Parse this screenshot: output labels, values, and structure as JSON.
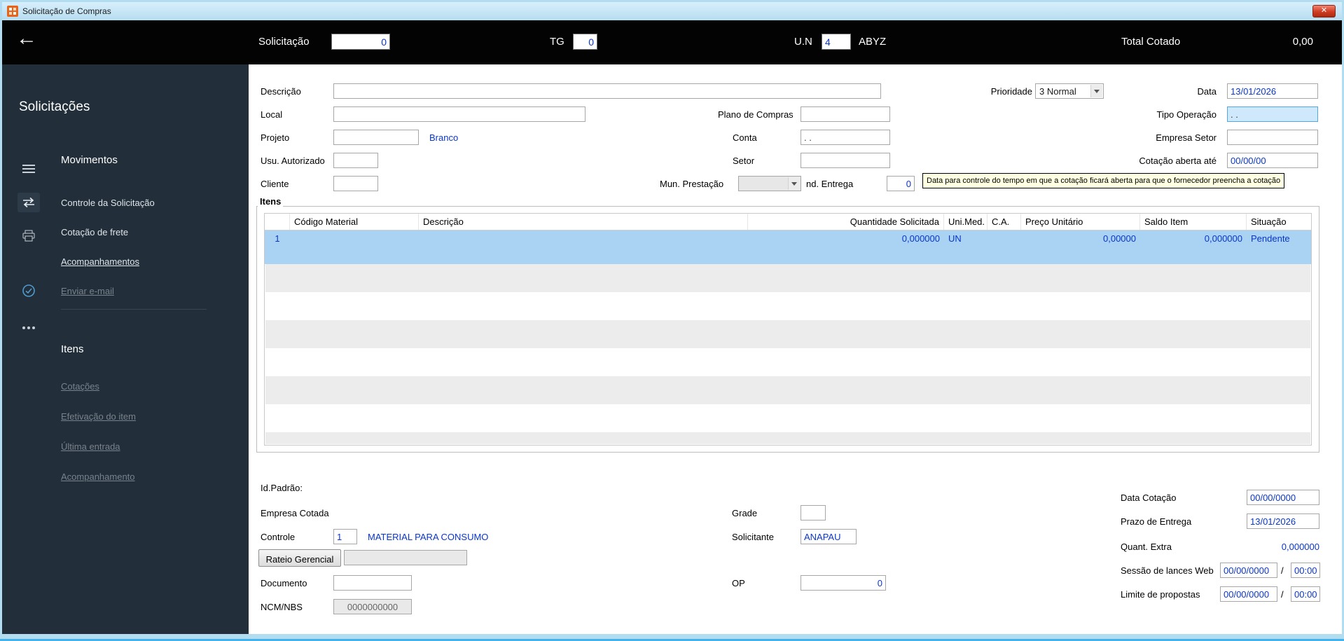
{
  "colors": {
    "accent_blue_text": "#0a36c8",
    "selected_row": "#a9d2f3",
    "tooltip_bg": "#ffffe1",
    "sidebar_bg": "#222e3a",
    "titlebar_bg": "#b6ddf0",
    "appbar_bg": "#030303",
    "close_button": "#cf3d22",
    "app_icon_orange": "#e8641b"
  },
  "titlebar": {
    "title": "Solicitação de Compras",
    "close": "✕"
  },
  "appbar": {
    "back": "←",
    "solicitacao": {
      "label": "Solicitação",
      "value": "0"
    },
    "tg": {
      "label": "TG",
      "value": "0"
    },
    "un": {
      "label": "U.N",
      "value": "4",
      "name": "ABYZ"
    },
    "total": {
      "label": "Total Cotado",
      "value": "0,00"
    }
  },
  "sidebar": {
    "title": "Solicitações",
    "movimentos": {
      "heading": "Movimentos",
      "items": [
        {
          "label": "Controle da Solicitação"
        },
        {
          "label": "Cotação de frete"
        },
        {
          "label": "Acompanhamentos"
        },
        {
          "label": "Enviar e-mail"
        }
      ]
    },
    "itens": {
      "heading": "Itens",
      "items": [
        {
          "label": "Cotações"
        },
        {
          "label": "Efetivação do item"
        },
        {
          "label": "Última entrada"
        },
        {
          "label": "Acompanhamento"
        }
      ]
    }
  },
  "form": {
    "descricao": {
      "label": "Descrição",
      "value": ""
    },
    "prioridade": {
      "label": "Prioridade",
      "value": "3 Normal"
    },
    "data": {
      "label": "Data",
      "value": "13/01/2026"
    },
    "local": {
      "label": "Local",
      "value": ""
    },
    "plano_compras": {
      "label": "Plano de Compras",
      "value": ""
    },
    "tipo_operacao": {
      "label": "Tipo Operação",
      "value": ". ."
    },
    "projeto": {
      "label": "Projeto",
      "value": "",
      "link": "Branco"
    },
    "conta": {
      "label": "Conta",
      "value": ". ."
    },
    "empresa_setor": {
      "label": "Empresa Setor",
      "value": ""
    },
    "usu_autorizado": {
      "label": "Usu. Autorizado",
      "value": ""
    },
    "setor": {
      "label": "Setor",
      "value": ""
    },
    "cotacao_aberta": {
      "label": "Cotação aberta até",
      "value": "00/00/00"
    },
    "cliente": {
      "label": "Cliente",
      "value": ""
    },
    "mun_prestacao": {
      "label": "Mun. Prestação",
      "value": ""
    },
    "und_entrega": {
      "label": "nd. Entrega",
      "value": "0"
    },
    "tooltip": "Data para controle do tempo em que a cotação ficará aberta para que o fornecedor preencha a cotação"
  },
  "grid": {
    "legend": "Itens",
    "columns": [
      "Código Material",
      "Descrição",
      "Quantidade Solicitada",
      "Uni.Med.",
      "C.A.",
      "Preço Unitário",
      "Saldo Item",
      "Situação"
    ],
    "row": {
      "num": "1",
      "codigo": "",
      "descricao": "",
      "quantidade": "0,000000",
      "unimed": "UN",
      "ca": "",
      "preco": "0,00000",
      "saldo": "0,000000",
      "situacao": "Pendente"
    }
  },
  "footer": {
    "id_padrao": "Id.Padrão:",
    "empresa_cotada": "Empresa Cotada",
    "grade": {
      "label": "Grade",
      "value": ""
    },
    "controle": {
      "label": "Controle",
      "value": "1",
      "desc": "MATERIAL PARA CONSUMO"
    },
    "solicitante": {
      "label": "Solicitante",
      "value": "ANAPAU"
    },
    "rateio": {
      "button": "Rateio Gerencial",
      "value": ""
    },
    "documento": {
      "label": "Documento",
      "value": ""
    },
    "op": {
      "label": "OP",
      "value": "0"
    },
    "ncm": {
      "label": "NCM/NBS",
      "value": "0000000000"
    },
    "data_cotacao": {
      "label": "Data Cotação",
      "value": "00/00/0000"
    },
    "prazo_entrega": {
      "label": "Prazo de Entrega",
      "value": "13/01/2026"
    },
    "quant_extra": {
      "label": "Quant. Extra",
      "value": "0,000000"
    },
    "sessao_lances": {
      "label": "Sessão de lances Web",
      "date": "00/00/0000",
      "time": "00:00"
    },
    "limite_propostas": {
      "label": "Limite de propostas",
      "date": "00/00/0000",
      "time": "00:00"
    },
    "slash": "/"
  }
}
